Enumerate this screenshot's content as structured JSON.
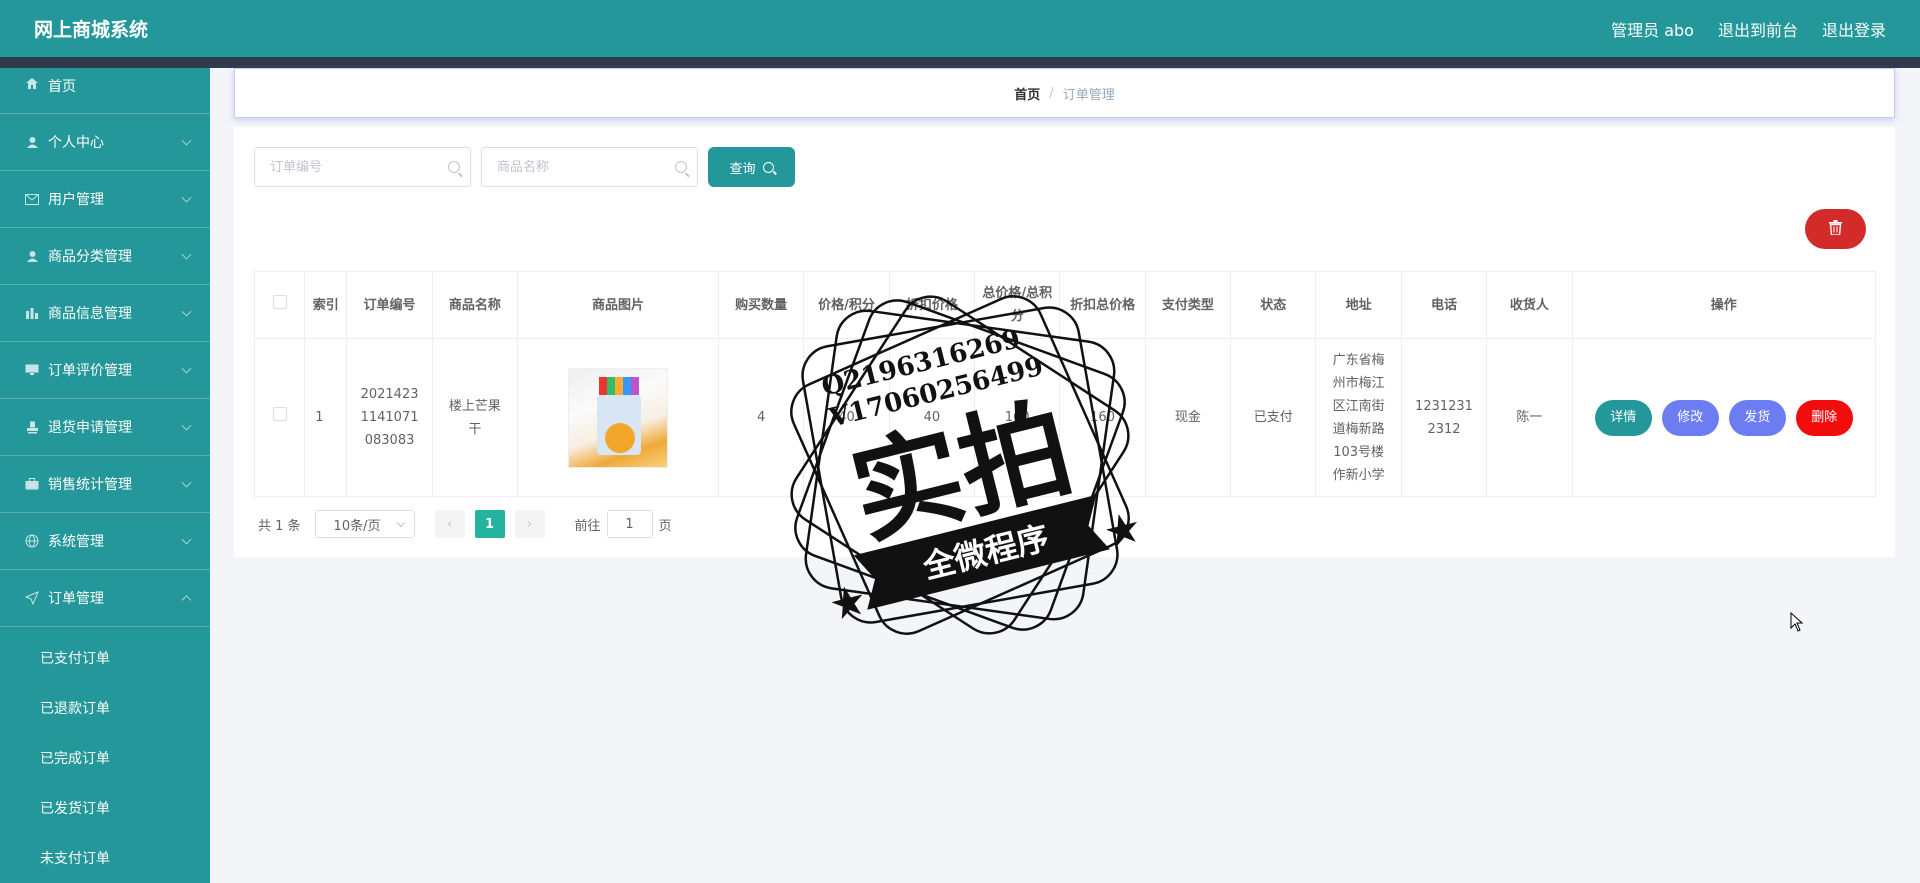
{
  "header": {
    "app_title": "网上商城系统",
    "admin_label": "管理员 abo",
    "exit_to_front": "退出到前台",
    "logout": "退出登录"
  },
  "sidebar": {
    "items": [
      {
        "label": "首页",
        "icon": "home-icon"
      },
      {
        "label": "个人中心",
        "icon": "user-icon"
      },
      {
        "label": "用户管理",
        "icon": "mail-icon"
      },
      {
        "label": "商品分类管理",
        "icon": "user-icon"
      },
      {
        "label": "商品信息管理",
        "icon": "chart-icon"
      },
      {
        "label": "订单评价管理",
        "icon": "monitor-icon"
      },
      {
        "label": "退货申请管理",
        "icon": "stamp-icon"
      },
      {
        "label": "销售统计管理",
        "icon": "briefcase-icon"
      },
      {
        "label": "系统管理",
        "icon": "globe-icon"
      },
      {
        "label": "订单管理",
        "icon": "send-icon"
      }
    ],
    "order_submenu": [
      "已支付订单",
      "已退款订单",
      "已完成订单",
      "已发货订单",
      "未支付订单"
    ]
  },
  "breadcrumb": {
    "home": "首页",
    "separator": "/",
    "current": "订单管理"
  },
  "search": {
    "order_no_placeholder": "订单编号",
    "product_name_placeholder": "商品名称",
    "query_label": "查询"
  },
  "table": {
    "headers": [
      "索引",
      "订单编号",
      "商品名称",
      "商品图片",
      "购买数量",
      "价格/积分",
      "折扣价格",
      "总价格/总积分",
      "折扣总价格",
      "支付类型",
      "状态",
      "地址",
      "电话",
      "收货人",
      "操作"
    ],
    "rows": [
      {
        "index": "1",
        "order_no": "20214231141071083083",
        "product_name": "楼上芒果干",
        "quantity": "4",
        "price": "40",
        "discount_price": "40",
        "total": "160",
        "discount_total": "160",
        "pay_type": "现金",
        "status": "已支付",
        "address": "广东省梅州市梅江区江南街道梅新路103号楼作新小学",
        "phone": "12312312312",
        "receiver": "陈一"
      }
    ],
    "actions": {
      "detail": "详情",
      "edit": "修改",
      "ship": "发货",
      "delete": "删除"
    }
  },
  "pagination": {
    "total_text": "共 1 条",
    "page_size": "10条/页",
    "current_page": "1",
    "goto_label": "前往",
    "goto_value": "1",
    "page_suffix": "页"
  },
  "watermark": {
    "line1": "Q2196316269",
    "line2": "V17060256499",
    "big_text": "实拍",
    "banner": "全微程序"
  },
  "colors": {
    "primary": "#23979a",
    "danger": "#d32b2a",
    "delete": "#f20d0d",
    "secondary": "#6b7df0",
    "page_active": "#23b39f"
  }
}
